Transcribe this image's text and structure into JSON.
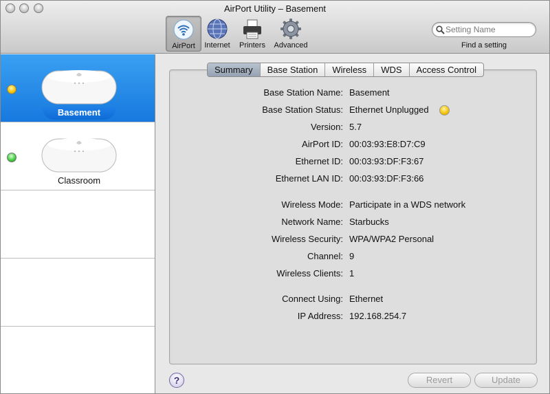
{
  "window": {
    "title": "AirPort Utility – Basement"
  },
  "toolbar": {
    "items": [
      {
        "label": "AirPort",
        "icon": "airport-icon",
        "selected": true
      },
      {
        "label": "Internet",
        "icon": "globe-icon",
        "selected": false
      },
      {
        "label": "Printers",
        "icon": "printer-icon",
        "selected": false
      },
      {
        "label": "Advanced",
        "icon": "gear-icon",
        "selected": false
      }
    ],
    "search": {
      "placeholder": "Setting Name",
      "value": "",
      "caption": "Find a setting"
    }
  },
  "sidebar": {
    "items": [
      {
        "label": "Basement",
        "status": "yellow",
        "selected": true
      },
      {
        "label": "Classroom",
        "status": "green",
        "selected": false
      }
    ]
  },
  "tabs": [
    {
      "label": "Summary",
      "active": true
    },
    {
      "label": "Base Station",
      "active": false
    },
    {
      "label": "Wireless",
      "active": false
    },
    {
      "label": "WDS",
      "active": false
    },
    {
      "label": "Access Control",
      "active": false
    }
  ],
  "summary": {
    "rows": [
      {
        "label": "Base Station Name:",
        "value": "Basement"
      },
      {
        "label": "Base Station Status:",
        "value": "Ethernet Unplugged",
        "indicator": "yellow"
      },
      {
        "label": "Version:",
        "value": "5.7"
      },
      {
        "label": "AirPort ID:",
        "value": "00:03:93:E8:D7:C9"
      },
      {
        "label": "Ethernet ID:",
        "value": "00:03:93:DF:F3:67"
      },
      {
        "label": "Ethernet LAN ID:",
        "value": "00:03:93:DF:F3:66"
      },
      {
        "label": "Wireless Mode:",
        "value": "Participate in a WDS network"
      },
      {
        "label": "Network Name:",
        "value": "Starbucks"
      },
      {
        "label": "Wireless Security:",
        "value": "WPA/WPA2 Personal"
      },
      {
        "label": "Channel:",
        "value": "9"
      },
      {
        "label": "Wireless Clients:",
        "value": "1"
      },
      {
        "label": "Connect Using:",
        "value": "Ethernet"
      },
      {
        "label": "IP Address:",
        "value": "192.168.254.7"
      }
    ]
  },
  "footer": {
    "help_label": "?",
    "revert_label": "Revert",
    "update_label": "Update"
  },
  "colors": {
    "selection": "#1779de",
    "status_yellow": "#f3c000",
    "status_green": "#3ccc3c"
  }
}
